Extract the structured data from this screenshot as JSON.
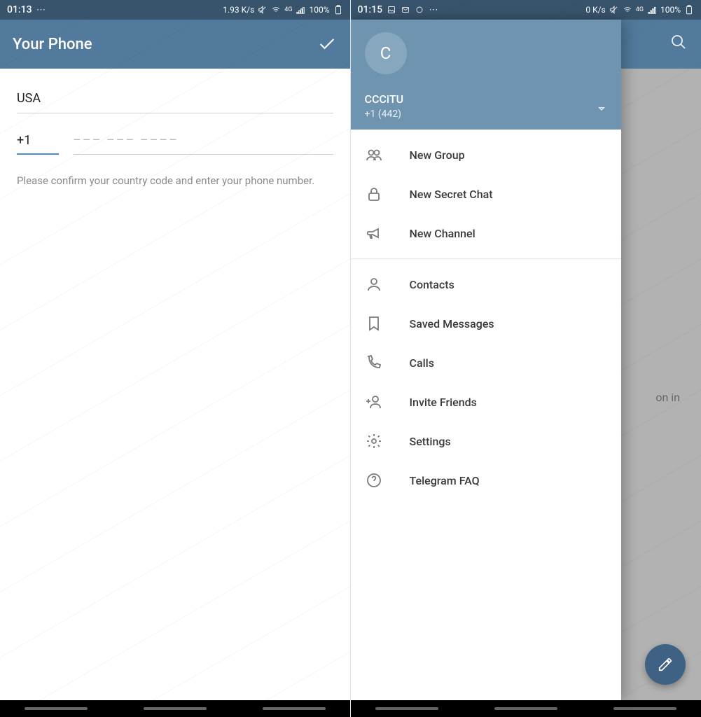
{
  "left": {
    "status": {
      "time": "01:13",
      "rate": "1.93 K/s",
      "net": "4G",
      "battery": "100%"
    },
    "title": "Your Phone",
    "country": "USA",
    "code": "+1",
    "placeholder": "––– ––– ––––",
    "hint": "Please confirm your country code and enter your phone number."
  },
  "right": {
    "status": {
      "time": "01:15",
      "rate": "0 K/s",
      "net": "4G",
      "battery": "100%"
    },
    "drawer": {
      "avatar_letter": "C",
      "username": "CCCiTU",
      "phone": "+1 (442)",
      "groups": [
        [
          {
            "name": "new-group",
            "icon": "group",
            "label": "New Group"
          },
          {
            "name": "new-secret-chat",
            "icon": "lock",
            "label": "New Secret Chat"
          },
          {
            "name": "new-channel",
            "icon": "megaphone",
            "label": "New Channel"
          }
        ],
        [
          {
            "name": "contacts",
            "icon": "person",
            "label": "Contacts"
          },
          {
            "name": "saved-messages",
            "icon": "bookmark",
            "label": "Saved Messages"
          },
          {
            "name": "calls",
            "icon": "phone",
            "label": "Calls"
          },
          {
            "name": "invite-friends",
            "icon": "addperson",
            "label": "Invite Friends"
          },
          {
            "name": "settings",
            "icon": "gear",
            "label": "Settings"
          },
          {
            "name": "telegram-faq",
            "icon": "help",
            "label": "Telegram FAQ"
          }
        ]
      ]
    },
    "bg_text": "on in"
  }
}
